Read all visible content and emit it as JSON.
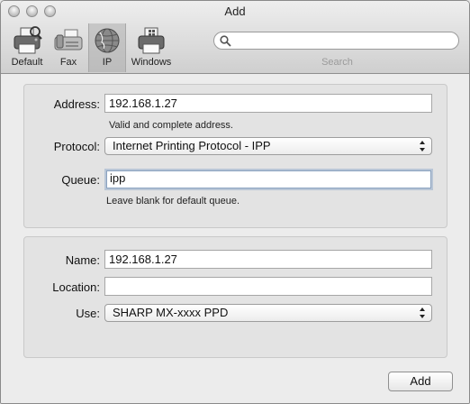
{
  "window": {
    "title": "Add"
  },
  "toolbar": {
    "items": [
      {
        "label": "Default",
        "icon": "printer-icon"
      },
      {
        "label": "Fax",
        "icon": "fax-icon"
      },
      {
        "label": "IP",
        "icon": "globe-icon",
        "selected": true
      },
      {
        "label": "Windows",
        "icon": "windows-printer-icon"
      }
    ],
    "search": {
      "value": "",
      "label": "Search"
    }
  },
  "connection": {
    "address_label": "Address:",
    "address_value": "192.168.1.27",
    "address_hint": "Valid and complete address.",
    "protocol_label": "Protocol:",
    "protocol_value": "Internet Printing Protocol - IPP",
    "queue_label": "Queue:",
    "queue_value": "ipp",
    "queue_hint": "Leave blank for default queue."
  },
  "printer": {
    "name_label": "Name:",
    "name_value": "192.168.1.27",
    "location_label": "Location:",
    "location_value": "",
    "use_label": "Use:",
    "use_value": "SHARP MX-xxxx PPD"
  },
  "actions": {
    "add_label": "Add"
  }
}
